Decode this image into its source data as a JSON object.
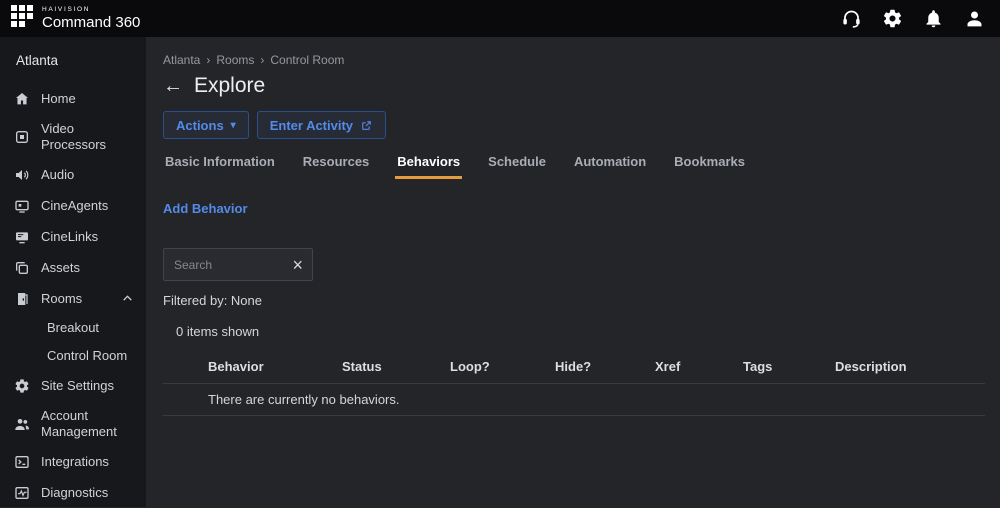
{
  "topbar": {
    "brand_small": "HAIVISION",
    "brand_large": "Command 360"
  },
  "sidebar": {
    "site": "Atlanta",
    "items": [
      {
        "label": "Home",
        "icon": "home-icon"
      },
      {
        "label": "Video Processors",
        "icon": "video-processors-icon"
      },
      {
        "label": "Audio",
        "icon": "audio-icon"
      },
      {
        "label": "CineAgents",
        "icon": "cineagents-icon"
      },
      {
        "label": "CineLinks",
        "icon": "cinelinks-icon"
      },
      {
        "label": "Assets",
        "icon": "assets-icon"
      },
      {
        "label": "Rooms",
        "icon": "rooms-icon",
        "expanded": true
      },
      {
        "label": "Site Settings",
        "icon": "site-settings-icon"
      },
      {
        "label": "Account Management",
        "icon": "account-management-icon"
      },
      {
        "label": "Integrations",
        "icon": "integrations-icon"
      },
      {
        "label": "Diagnostics",
        "icon": "diagnostics-icon"
      }
    ],
    "rooms_children": [
      "Breakout",
      "Control Room"
    ]
  },
  "main": {
    "breadcrumb": [
      "Atlanta",
      "Rooms",
      "Control Room"
    ],
    "breadcrumb_separator": "›",
    "back_icon": "←",
    "title": "Explore",
    "actions_label": "Actions",
    "actions_caret": "▾",
    "enter_activity_label": "Enter Activity",
    "tabs": [
      "Basic Information",
      "Resources",
      "Behaviors",
      "Schedule",
      "Automation",
      "Bookmarks"
    ],
    "active_tab": "Behaviors",
    "add_behavior_label": "Add Behavior",
    "search_placeholder": "Search",
    "clear_icon": "×",
    "filtered_by": "Filtered by: None",
    "items_shown": "0 items shown",
    "table": {
      "headers": [
        "Behavior",
        "Status",
        "Loop?",
        "Hide?",
        "Xref",
        "Tags",
        "Description"
      ],
      "empty_message": "There are currently no behaviors."
    },
    "colors": {
      "accent_blue": "#548ae8",
      "accent_orange": "#e69b3f"
    }
  }
}
